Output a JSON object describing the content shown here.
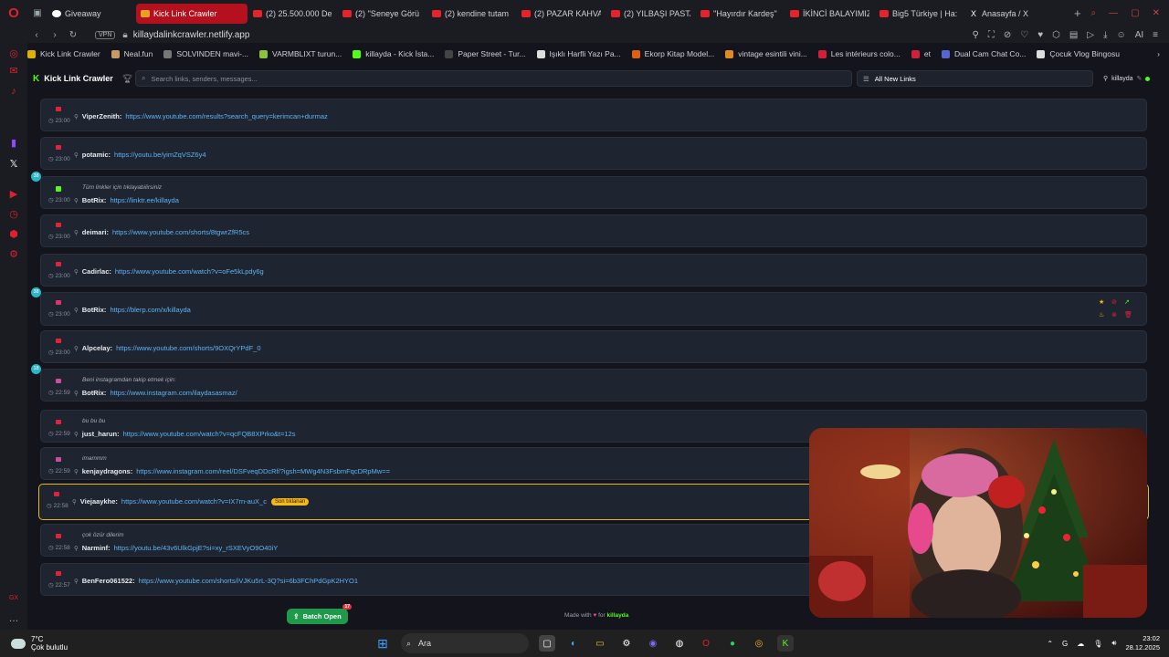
{
  "browser": {
    "tabs": [
      {
        "label": "Giveaway",
        "icon": "giveaway-favicon"
      },
      {
        "label": "Kick Link Crawler",
        "icon": "kick-favicon",
        "active": true
      },
      {
        "label": "(2) 25.500.000 De",
        "icon": "youtube-favicon"
      },
      {
        "label": "(2) ''Seneye Görü",
        "icon": "youtube-favicon"
      },
      {
        "label": "(2) kendine tutam",
        "icon": "youtube-favicon"
      },
      {
        "label": "(2) PAZAR KAHVA",
        "icon": "youtube-favicon"
      },
      {
        "label": "(2) YILBAŞI PASTA",
        "icon": "youtube-favicon"
      },
      {
        "label": "''Hayırdır Kardeş''",
        "icon": "youtube-favicon"
      },
      {
        "label": "İKİNCİ BALAYIMIZ",
        "icon": "youtube-favicon"
      },
      {
        "label": "Big5 Türkiye | Ha:",
        "icon": "youtube-favicon"
      },
      {
        "label": "Anasayfa / X",
        "icon": "x-favicon"
      }
    ],
    "vpn_label": "VPN",
    "url": "killaydalinkcrawler.netlify.app",
    "bookmarks": [
      {
        "label": "Kick Link Crawler",
        "color": "#e0b000"
      },
      {
        "label": "Neal.fun",
        "color": "#c79a63"
      },
      {
        "label": "SOLVINDEN mavi-...",
        "color": "#777777"
      },
      {
        "label": "VARMBLIXT turun...",
        "color": "#8ac43f"
      },
      {
        "label": "killayda - Kick İsta...",
        "color": "#53fc18"
      },
      {
        "label": "Paper Street - Tur...",
        "color": "#444444"
      },
      {
        "label": "Işıklı Harfli Yazı Pa...",
        "color": "#dddddd"
      },
      {
        "label": "Ekorp Kitap Model...",
        "color": "#e06010"
      },
      {
        "label": "vintage esintili vini...",
        "color": "#e08a20"
      },
      {
        "label": "Les intérieurs colo...",
        "color": "#d0203a"
      },
      {
        "label": "et",
        "color": "#d0203a"
      },
      {
        "label": "Dual Cam Chat Co...",
        "color": "#5566cc"
      },
      {
        "label": "Çocuk Vlog Bingosu",
        "color": "#dddddd"
      }
    ]
  },
  "app": {
    "title": "Kick Link Crawler",
    "search_placeholder": "Search links, senders, messages...",
    "filter_label": "All New Links",
    "username": "killayda"
  },
  "feed": [
    {
      "time": "23:00",
      "platform": "youtube",
      "sender": "ViperZenith:",
      "link": "https://www.youtube.com/results?search_query=kerimcan+durmaz",
      "message": "",
      "count": ""
    },
    {
      "time": "23:00",
      "platform": "youtube",
      "sender": "potamic:",
      "link": "https://youtu.be/yimZqVSZ6y4",
      "message": "",
      "count": ""
    },
    {
      "time": "23:00",
      "platform": "kick",
      "sender": "BotRix:",
      "link": "https://linktr.ee/killayda",
      "message": "Tüm linkler için tıklayabilirsiniz",
      "count": "38"
    },
    {
      "time": "23:00",
      "platform": "youtube",
      "sender": "deimari:",
      "link": "https://www.youtube.com/shorts/8tgwrZfR5cs",
      "message": "",
      "count": ""
    },
    {
      "time": "23:00",
      "platform": "youtube",
      "sender": "Cadirlac:",
      "link": "https://www.youtube.com/watch?v=oFe5kLpdy6g",
      "message": "",
      "count": ""
    },
    {
      "time": "23:00",
      "platform": "other",
      "sender": "BotRix:",
      "link": "https://blerp.com/x/killayda",
      "message": "",
      "count": "38"
    },
    {
      "time": "23:00",
      "platform": "youtube",
      "sender": "Alpcelay:",
      "link": "https://www.youtube.com/shorts/9OXQrYPdF_0",
      "message": "",
      "count": ""
    },
    {
      "time": "22:59",
      "platform": "instagram",
      "sender": "BotRix:",
      "link": "https://www.instagram.com/ilaydasasmaz/",
      "message": "Beni instagramdan takip etmek için:",
      "count": "18"
    },
    {
      "time": "22:59",
      "platform": "youtube",
      "sender": "just_harun:",
      "link": "https://www.youtube.com/watch?v=qcFQB8XPrko&t=12s",
      "message": "bu bu bu",
      "count": ""
    },
    {
      "time": "22:59",
      "platform": "instagram",
      "sender": "kenjaydragons:",
      "link": "https://www.instagram.com/reel/DSFveqDDcRf/?igsh=MWg4N3FsbmFqcDRpMw==",
      "message": "imammm",
      "count": ""
    },
    {
      "time": "22:58",
      "platform": "youtube",
      "sender": "Viejaaykhe:",
      "link": "https://www.youtube.com/watch?v=IX7rn-auX_c",
      "message": "",
      "count": "",
      "badge": "Son tıklanan",
      "highlight": true
    },
    {
      "time": "22:58",
      "platform": "youtube",
      "sender": "Narminf:",
      "link": "https://youtu.be/43v6UlkGpjE?si=xy_rSXEVyO9O40iY",
      "message": "çok özür dilerim",
      "count": ""
    },
    {
      "time": "22:57",
      "platform": "youtube",
      "sender": "BenFero061522:",
      "link": "https://www.youtube.com/shorts/iVJKu5rL-3Q?si=6b3FChPdGpK2HYO1",
      "message": "",
      "count": ""
    }
  ],
  "footer": {
    "batch_label": "Batch Open",
    "batch_count": "17",
    "made_with_prefix": "Made with",
    "made_with_for": "for",
    "made_with_user": "killayda"
  },
  "taskbar": {
    "temperature": "7°C",
    "weather": "Çok bulutlu",
    "search_label": "Ara",
    "time": "23:02",
    "date": "28.12.2025"
  }
}
